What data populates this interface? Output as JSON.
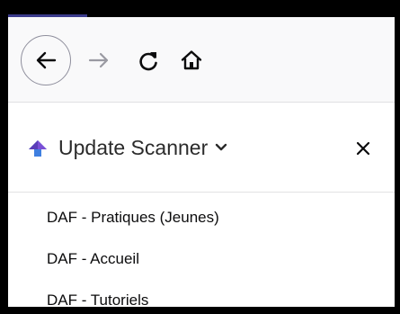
{
  "toolbar": {
    "icons": {
      "back": "back-arrow-icon",
      "forward": "forward-arrow-icon",
      "reload": "reload-icon",
      "home": "home-icon"
    }
  },
  "panel": {
    "title": "Update Scanner",
    "logo_icon": "update-scanner-logo-icon",
    "dropdown_icon": "chevron-down-icon",
    "close_icon": "close-icon"
  },
  "items": [
    "DAF - Pratiques (Jeunes)",
    "DAF - Accueil",
    "DAF - Tutoriels"
  ],
  "colors": {
    "logo_top": "#7b4fd6",
    "logo_bottom": "#3f7fe0",
    "accent_line": "#3b3b8c",
    "icon": "#0c0c0d",
    "disabled_icon": "#9a9aa2"
  }
}
